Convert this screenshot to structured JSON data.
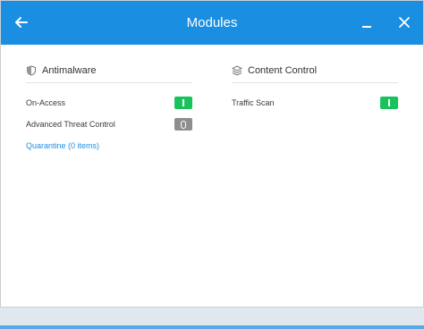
{
  "window": {
    "title": "Modules",
    "colors": {
      "titlebar": "#1a8ee0",
      "toggle_on": "#19c35c",
      "toggle_off": "#8e8e8e",
      "link": "#1d8fe0"
    }
  },
  "antimalware": {
    "heading": "Antimalware",
    "icon": "shield-icon",
    "rows": [
      {
        "label": "On-Access",
        "state": "on"
      },
      {
        "label": "Advanced Threat Control",
        "state": "off"
      }
    ],
    "quarantine_link": "Quarantine (0 items)"
  },
  "content_control": {
    "heading": "Content Control",
    "icon": "layers-icon",
    "rows": [
      {
        "label": "Traffic Scan",
        "state": "on"
      }
    ]
  }
}
